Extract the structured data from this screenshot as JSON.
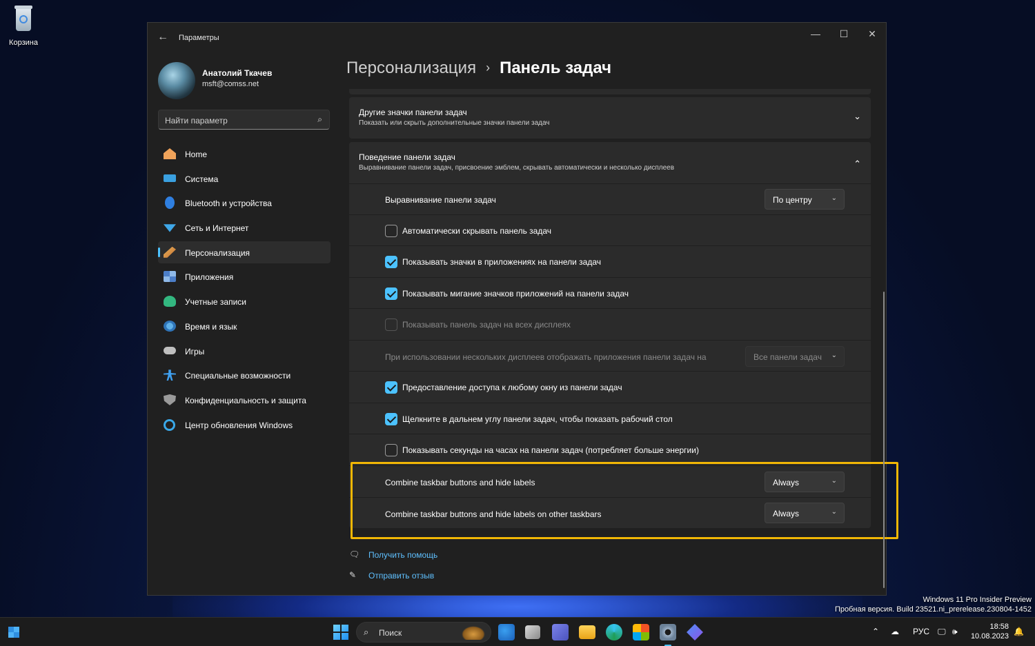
{
  "desktop": {
    "recycle_bin_label": "Корзина",
    "watermark_line1": "Windows 11 Pro Insider Preview",
    "watermark_line2": "Пробная версия. Build 23521.ni_prerelease.230804-1452"
  },
  "window": {
    "app_title": "Параметры",
    "back_glyph": "←",
    "minimize_glyph": "—",
    "maximize_glyph": "☐",
    "close_glyph": "✕"
  },
  "profile": {
    "name": "Анатолий Ткачев",
    "email": "msft@comss.net"
  },
  "search": {
    "placeholder": "Найти параметр",
    "icon": "⌕"
  },
  "nav": {
    "items": [
      {
        "label": "Home",
        "icon": "home-icon"
      },
      {
        "label": "Система",
        "icon": "system-icon"
      },
      {
        "label": "Bluetooth и устройства",
        "icon": "bluetooth-icon"
      },
      {
        "label": "Сеть и Интернет",
        "icon": "network-icon"
      },
      {
        "label": "Персонализация",
        "icon": "personalization-icon",
        "active": true
      },
      {
        "label": "Приложения",
        "icon": "apps-icon"
      },
      {
        "label": "Учетные записи",
        "icon": "accounts-icon"
      },
      {
        "label": "Время и язык",
        "icon": "time-language-icon"
      },
      {
        "label": "Игры",
        "icon": "gaming-icon"
      },
      {
        "label": "Специальные возможности",
        "icon": "accessibility-icon"
      },
      {
        "label": "Конфиденциальность и защита",
        "icon": "privacy-icon"
      },
      {
        "label": "Центр обновления Windows",
        "icon": "windows-update-icon"
      }
    ]
  },
  "breadcrumb": {
    "parent": "Персонализация",
    "separator": "›",
    "current": "Панель задач"
  },
  "sections": {
    "other_icons": {
      "title": "Другие значки панели задач",
      "subtitle": "Показать или скрыть дополнительные значки панели задач",
      "chevron": "⌄"
    },
    "behavior": {
      "title": "Поведение панели задач",
      "subtitle": "Выравнивание панели задач, присвоение эмблем, скрывать автоматически и несколько дисплеев",
      "chevron": "⌃"
    }
  },
  "settings": {
    "alignment_label": "Выравнивание панели задач",
    "alignment_value": "По центру",
    "autohide_label": "Автоматически скрывать панель задач",
    "autohide_checked": false,
    "badges_label": "Показывать значки в приложениях на панели задач",
    "badges_checked": true,
    "flashing_label": "Показывать мигание значков приложений на панели задач",
    "flashing_checked": true,
    "all_displays_label": "Показывать панель задач на всех дисплеях",
    "all_displays_checked": false,
    "multi_display_label": "При использовании нескольких дисплеев отображать приложения панели задач на",
    "multi_display_value": "Все панели задач",
    "share_window_label": "Предоставление доступа к любому окну из панели задач",
    "share_window_checked": true,
    "corner_desktop_label": "Щелкните в дальнем углу панели задач, чтобы показать рабочий стол",
    "corner_desktop_checked": true,
    "seconds_label": "Показывать секунды на часах на панели задач (потребляет больше энергии)",
    "seconds_checked": false,
    "combine_label": "Combine taskbar buttons and hide labels",
    "combine_value": "Always",
    "combine_other_label": "Combine taskbar buttons and hide labels on other taskbars",
    "combine_other_value": "Always",
    "dropdown_chevron": "⌄"
  },
  "help": {
    "get_help": "Получить помощь",
    "feedback": "Отправить отзыв"
  },
  "taskbar": {
    "search_placeholder": "Поиск",
    "search_icon": "⌕",
    "language": "РУС",
    "time": "18:58",
    "date": "10.08.2023",
    "tray_chevron": "⌃",
    "cloud_glyph": "☁",
    "volume_glyph": "🕪",
    "notification_glyph": "🔔"
  },
  "colors": {
    "accent": "#4cc2ff",
    "highlight_frame": "#f2b705",
    "window_bg": "#202020",
    "card_bg": "#2b2b2b"
  }
}
